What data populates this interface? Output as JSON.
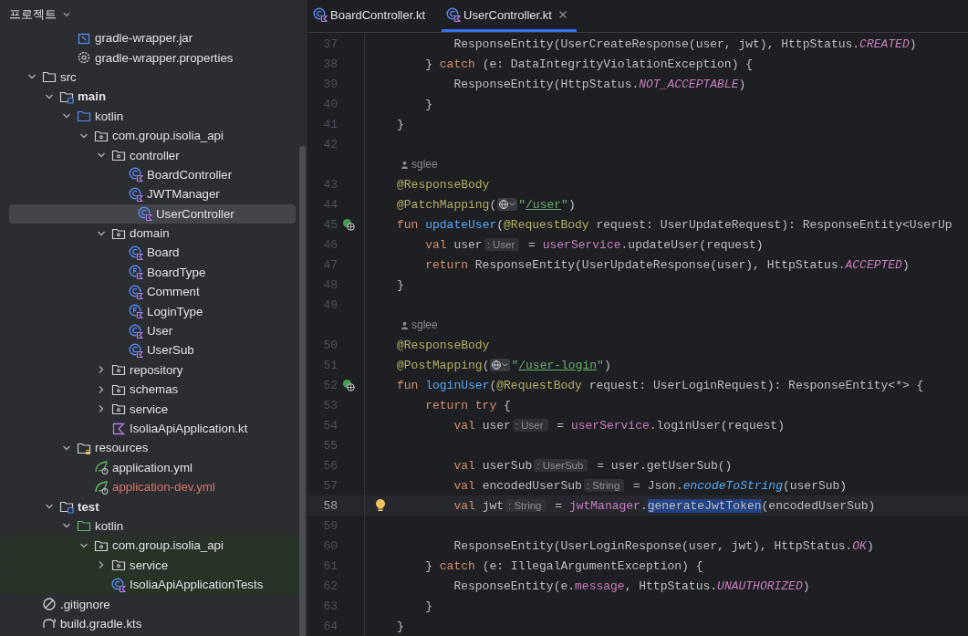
{
  "project_panel": {
    "title": "프로젝트",
    "items_above": [
      {
        "label": "gradle-wrapper.jar",
        "kind": "jar",
        "selected": false
      },
      {
        "label": "gradle-wrapper.properties",
        "kind": "properties",
        "selected": false
      }
    ],
    "items": [
      {
        "label": "src",
        "kind": "folder",
        "expanded": true,
        "selected": false,
        "children": [
          {
            "label": "main",
            "kind": "module",
            "expanded": true,
            "selected": false,
            "children": [
              {
                "label": "kotlin",
                "kind": "source_root",
                "expanded": true,
                "selected": false,
                "children": [
                  {
                    "label": "com.group.isolia_api",
                    "kind": "package",
                    "expanded": true,
                    "selected": false,
                    "children": [
                      {
                        "label": "controller",
                        "kind": "package",
                        "expanded": true,
                        "selected": false,
                        "children": [
                          {
                            "label": "BoardController",
                            "kind": "class",
                            "selected": false
                          },
                          {
                            "label": "JWTManager",
                            "kind": "class",
                            "selected": false
                          },
                          {
                            "label": "UserController",
                            "kind": "class",
                            "selected": true
                          }
                        ]
                      },
                      {
                        "label": "domain",
                        "kind": "package",
                        "expanded": true,
                        "selected": false,
                        "children": [
                          {
                            "label": "Board",
                            "kind": "class",
                            "selected": false
                          },
                          {
                            "label": "BoardType",
                            "kind": "enum",
                            "selected": false
                          },
                          {
                            "label": "Comment",
                            "kind": "class",
                            "selected": false
                          },
                          {
                            "label": "LoginType",
                            "kind": "enum",
                            "selected": false
                          },
                          {
                            "label": "User",
                            "kind": "class",
                            "selected": false
                          },
                          {
                            "label": "UserSub",
                            "kind": "class",
                            "selected": false
                          }
                        ]
                      },
                      {
                        "label": "repository",
                        "kind": "package",
                        "expanded": false,
                        "selected": false
                      },
                      {
                        "label": "schemas",
                        "kind": "package",
                        "expanded": false,
                        "selected": false
                      },
                      {
                        "label": "service",
                        "kind": "package",
                        "expanded": false,
                        "selected": false
                      },
                      {
                        "label": "IsoliaApiApplication.kt",
                        "kind": "kotlin_file",
                        "selected": false
                      }
                    ]
                  }
                ]
              },
              {
                "label": "resources",
                "kind": "resources",
                "expanded": true,
                "selected": false,
                "children": [
                  {
                    "label": "application.yml",
                    "kind": "spring_config",
                    "selected": false
                  },
                  {
                    "label": "application-dev.yml",
                    "kind": "spring_config",
                    "selected": false,
                    "color": "#d5756c"
                  }
                ]
              }
            ]
          },
          {
            "label": "test",
            "kind": "module",
            "expanded": true,
            "selected": false,
            "children": [
              {
                "label": "kotlin",
                "kind": "test_root",
                "expanded": true,
                "selected": false,
                "children": [
                  {
                    "label": "com.group.isolia_api",
                    "kind": "package",
                    "expanded": true,
                    "selected": false,
                    "children": [
                      {
                        "label": "service",
                        "kind": "package",
                        "expanded": false,
                        "selected": false
                      },
                      {
                        "label": "IsoliaApiApplicationTests",
                        "kind": "class",
                        "selected": false
                      }
                    ]
                  }
                ]
              }
            ]
          }
        ]
      },
      {
        "label": ".gitignore",
        "kind": "gitignore",
        "selected": false
      },
      {
        "label": "build.gradle.kts",
        "kind": "gradle",
        "selected": false
      }
    ]
  },
  "editor": {
    "tabs": [
      {
        "label": "BoardController.kt",
        "selected": false
      },
      {
        "label": "UserController.kt",
        "selected": true
      }
    ],
    "lines": [
      {
        "number": "37",
        "tokens": [
          {
            "text": "        ResponseEntity(UserCreateResponse(user, jwt), HttpStatus.",
            "kind": "plain"
          },
          {
            "text": "CREATED",
            "kind": "constant"
          },
          {
            "text": ")",
            "kind": "plain"
          }
        ]
      },
      {
        "number": "38",
        "tokens": [
          {
            "text": "    } ",
            "kind": "plain"
          },
          {
            "text": "catch",
            "kind": "keyword"
          },
          {
            "text": " (e: DataIntegrityViolationException) {",
            "kind": "plain"
          }
        ]
      },
      {
        "number": "39",
        "tokens": [
          {
            "text": "        ResponseEntity(HttpStatus.",
            "kind": "plain"
          },
          {
            "text": "NOT_ACCEPTABLE",
            "kind": "constant"
          },
          {
            "text": ")",
            "kind": "plain"
          }
        ]
      },
      {
        "number": "40",
        "tokens": [
          {
            "text": "    }",
            "kind": "plain"
          }
        ]
      },
      {
        "number": "41",
        "tokens": [
          {
            "text": "}",
            "kind": "plain"
          }
        ]
      },
      {
        "number": "42"
      },
      {
        "author": "sglee"
      },
      {
        "number": "43",
        "tokens": [
          {
            "text": "@ResponseBody",
            "kind": "annotation"
          }
        ]
      },
      {
        "number": "44",
        "tokens": [
          {
            "text": "@PatchMapping",
            "kind": "annotation"
          },
          {
            "text": "(",
            "kind": "plain"
          },
          {
            "kind": "globe"
          },
          {
            "text": "\"",
            "kind": "string"
          },
          {
            "text": "/user",
            "kind": "url"
          },
          {
            "text": "\"",
            "kind": "string"
          },
          {
            "text": ")",
            "kind": "plain"
          }
        ]
      },
      {
        "number": "45",
        "endpoint_marker": true,
        "tokens": [
          {
            "text": "fun ",
            "kind": "keyword"
          },
          {
            "text": "updateUser",
            "kind": "declaration"
          },
          {
            "text": "(",
            "kind": "plain"
          },
          {
            "text": "@RequestBody",
            "kind": "annotation"
          },
          {
            "text": " request: UserUpdateRequest): ResponseEntity<UserUp",
            "kind": "plain"
          }
        ]
      },
      {
        "number": "46",
        "tokens": [
          {
            "text": "    val",
            "kind": "keyword"
          },
          {
            "text": " user",
            "kind": "plain"
          },
          {
            "text": ": User",
            "kind": "hint"
          },
          {
            "text": " = ",
            "kind": "plain"
          },
          {
            "text": "userService",
            "kind": "property"
          },
          {
            "text": ".updateUser(request)",
            "kind": "plain"
          }
        ]
      },
      {
        "number": "47",
        "tokens": [
          {
            "text": "    return",
            "kind": "keyword"
          },
          {
            "text": " ResponseEntity(UserUpdateResponse(user), HttpStatus.",
            "kind": "plain"
          },
          {
            "text": "ACCEPTED",
            "kind": "constant"
          },
          {
            "text": ")",
            "kind": "plain"
          }
        ]
      },
      {
        "number": "48",
        "tokens": [
          {
            "text": "}",
            "kind": "plain"
          }
        ]
      },
      {
        "number": "49"
      },
      {
        "author": "sglee"
      },
      {
        "number": "50",
        "tokens": [
          {
            "text": "@ResponseBody",
            "kind": "annotation"
          }
        ]
      },
      {
        "number": "51",
        "tokens": [
          {
            "text": "@PostMapping",
            "kind": "annotation"
          },
          {
            "text": "(",
            "kind": "plain"
          },
          {
            "kind": "globe"
          },
          {
            "text": "\"",
            "kind": "string"
          },
          {
            "text": "/user-login",
            "kind": "url"
          },
          {
            "text": "\"",
            "kind": "string"
          },
          {
            "text": ")",
            "kind": "plain"
          }
        ]
      },
      {
        "number": "52",
        "endpoint_marker": true,
        "tokens": [
          {
            "text": "fun ",
            "kind": "keyword"
          },
          {
            "text": "loginUser",
            "kind": "declaration"
          },
          {
            "text": "(",
            "kind": "plain"
          },
          {
            "text": "@RequestBody",
            "kind": "annotation"
          },
          {
            "text": " request: UserLoginRequest): ResponseEntity<*> {",
            "kind": "plain"
          }
        ]
      },
      {
        "number": "53",
        "tokens": [
          {
            "text": "    return try",
            "kind": "keyword"
          },
          {
            "text": " {",
            "kind": "plain"
          }
        ]
      },
      {
        "number": "54",
        "tokens": [
          {
            "text": "        val",
            "kind": "keyword"
          },
          {
            "text": " user",
            "kind": "plain"
          },
          {
            "text": ": User",
            "kind": "hint"
          },
          {
            "text": " = ",
            "kind": "plain"
          },
          {
            "text": "userService",
            "kind": "property"
          },
          {
            "text": ".loginUser(request)",
            "kind": "plain"
          }
        ]
      },
      {
        "number": "55"
      },
      {
        "number": "56",
        "tokens": [
          {
            "text": "        val",
            "kind": "keyword"
          },
          {
            "text": " userSub",
            "kind": "plain"
          },
          {
            "text": ": UserSub",
            "kind": "hint"
          },
          {
            "text": " = user.getUserSub()",
            "kind": "plain"
          }
        ]
      },
      {
        "number": "57",
        "tokens": [
          {
            "text": "        val",
            "kind": "keyword"
          },
          {
            "text": " encodedUserSub",
            "kind": "plain"
          },
          {
            "text": ": String",
            "kind": "hint"
          },
          {
            "text": " = Json.",
            "kind": "plain"
          },
          {
            "text": "encodeToString",
            "kind": "extension"
          },
          {
            "text": "(userSub)",
            "kind": "plain"
          }
        ]
      },
      {
        "number": "58",
        "current": true,
        "intention_bulb": true,
        "tokens": [
          {
            "text": "        val",
            "kind": "keyword"
          },
          {
            "text": " jwt",
            "kind": "plain"
          },
          {
            "text": ": String",
            "kind": "hint"
          },
          {
            "text": " = ",
            "kind": "plain"
          },
          {
            "text": "jwtManager",
            "kind": "property"
          },
          {
            "text": ".",
            "kind": "plain"
          },
          {
            "text": "generateJwtToken",
            "kind": "selection"
          },
          {
            "text": "(encodedUserSub)",
            "kind": "plain"
          }
        ]
      },
      {
        "number": "59"
      },
      {
        "number": "60",
        "tokens": [
          {
            "text": "        ResponseEntity(UserLoginResponse(user, jwt), HttpStatus.",
            "kind": "plain"
          },
          {
            "text": "OK",
            "kind": "constant"
          },
          {
            "text": ")",
            "kind": "plain"
          }
        ]
      },
      {
        "number": "61",
        "tokens": [
          {
            "text": "    } ",
            "kind": "plain"
          },
          {
            "text": "catch",
            "kind": "keyword"
          },
          {
            "text": " (e: IllegalArgumentException) {",
            "kind": "plain"
          }
        ]
      },
      {
        "number": "62",
        "tokens": [
          {
            "text": "        ResponseEntity(e.",
            "kind": "plain"
          },
          {
            "text": "message",
            "kind": "property"
          },
          {
            "text": ", HttpStatus.",
            "kind": "plain"
          },
          {
            "text": "UNAUTHORIZED",
            "kind": "constant"
          },
          {
            "text": ")",
            "kind": "plain"
          }
        ]
      },
      {
        "number": "63",
        "tokens": [
          {
            "text": "    }",
            "kind": "plain"
          }
        ]
      },
      {
        "number": "64",
        "tokens": [
          {
            "text": "}",
            "kind": "plain"
          }
        ]
      }
    ]
  }
}
